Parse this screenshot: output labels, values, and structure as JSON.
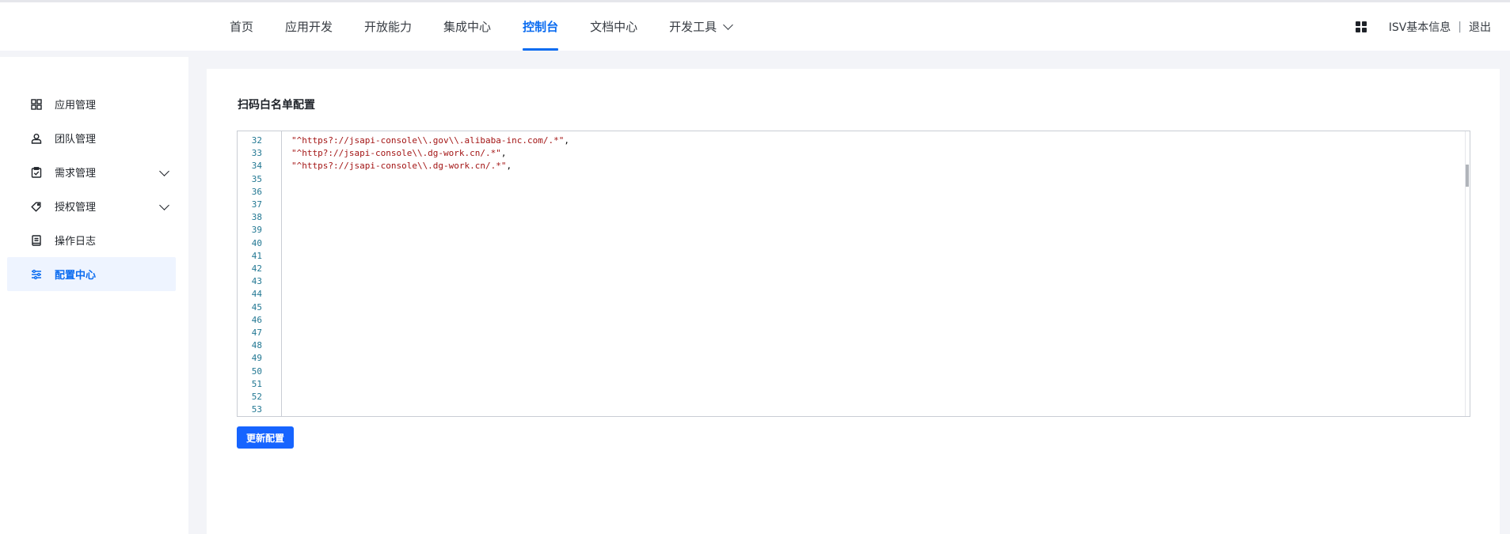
{
  "nav": {
    "items": [
      {
        "label": "首页",
        "active": false
      },
      {
        "label": "应用开发",
        "active": false
      },
      {
        "label": "开放能力",
        "active": false
      },
      {
        "label": "集成中心",
        "active": false
      },
      {
        "label": "控制台",
        "active": true
      },
      {
        "label": "文档中心",
        "active": false
      },
      {
        "label": "开发工具",
        "active": false,
        "dropdown": true
      }
    ]
  },
  "header_right": {
    "apps_icon": "grid-icon",
    "isv_info": "ISV基本信息",
    "separator": "|",
    "logout": "退出"
  },
  "sidebar": {
    "items": [
      {
        "label": "应用管理",
        "icon": "apps-icon",
        "expandable": false,
        "active": false
      },
      {
        "label": "团队管理",
        "icon": "team-icon",
        "expandable": false,
        "active": false
      },
      {
        "label": "需求管理",
        "icon": "clipboard-check-icon",
        "expandable": true,
        "active": false
      },
      {
        "label": "授权管理",
        "icon": "tag-icon",
        "expandable": true,
        "active": false
      },
      {
        "label": "操作日志",
        "icon": "log-book-icon",
        "expandable": false,
        "active": false
      },
      {
        "label": "配置中心",
        "icon": "sliders-icon",
        "expandable": false,
        "active": true
      }
    ]
  },
  "main": {
    "title": "扫码白名单配置",
    "editor": {
      "line_numbers": [
        "32",
        "33",
        "34",
        "35",
        "36",
        "37",
        "38",
        "39",
        "40",
        "41",
        "42",
        "43",
        "44",
        "45",
        "46",
        "47",
        "48",
        "49",
        "50",
        "51",
        "52",
        "53"
      ],
      "code_lines": [
        {
          "string": "\"^https?://jsapi-console\\\\.gov\\\\.alibaba-inc.com/.*\"",
          "trail": ","
        },
        {
          "string": "\"^http?://jsapi-console\\\\.dg-work.cn/.*\"",
          "trail": ","
        },
        {
          "string": "\"^https?://jsapi-console\\\\.dg-work.cn/.*\"",
          "trail": ","
        }
      ]
    },
    "update_button": "更新配置"
  },
  "colors": {
    "accent": "#0b6cf0",
    "button": "#1664ff",
    "code_string": "#a31515",
    "line_number": "#237893"
  }
}
